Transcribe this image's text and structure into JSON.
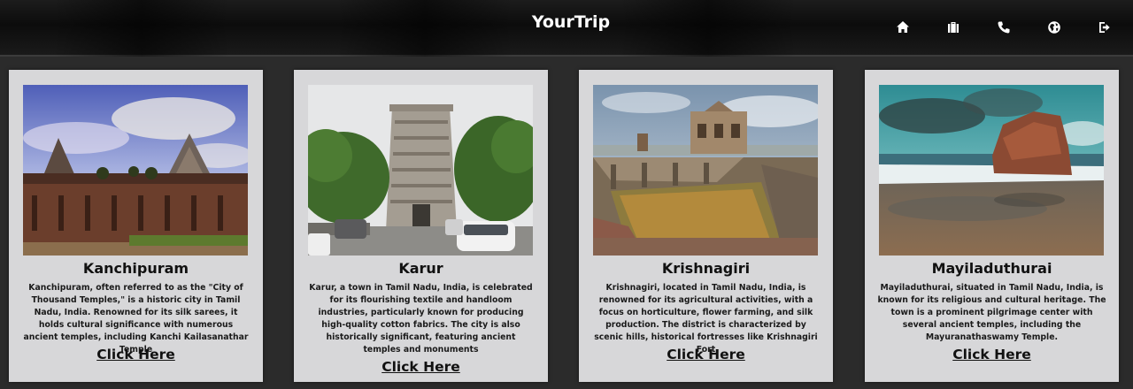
{
  "header": {
    "brand": "YourTrip",
    "nav": [
      {
        "icon": "home-icon"
      },
      {
        "icon": "briefcase-icon"
      },
      {
        "icon": "phone-icon"
      },
      {
        "icon": "globe-icon"
      },
      {
        "icon": "logout-icon"
      }
    ]
  },
  "cards": [
    {
      "title": "Kanchipuram",
      "description": "Kanchipuram, often referred to as the \"City of Thousand Temples,\" is a historic city in Tamil Nadu, India. Renowned for its silk sarees, it holds cultural significance with numerous ancient temples, including Kanchi Kailasanathar Temple",
      "link": "Click Here"
    },
    {
      "title": "Karur",
      "description": "Karur, a town in Tamil Nadu, India, is celebrated for its flourishing textile and handloom industries, particularly known for producing high-quality cotton fabrics. The city is also historically significant, featuring ancient temples and monuments",
      "link": "Click Here"
    },
    {
      "title": "Krishnagiri",
      "description": "Krishnagiri, located in Tamil Nadu, India, is renowned for its agricultural activities, with a focus on horticulture, flower farming, and silk production. The district is characterized by scenic hills, historical fortresses like Krishnagiri Fort",
      "link": "Click Here"
    },
    {
      "title": "Mayiladuthurai",
      "description": "Mayiladuthurai, situated in Tamil Nadu, India, is known for its religious and cultural heritage. The town is a prominent pilgrimage center with several ancient temples, including the Mayuranathaswamy Temple.",
      "link": "Click Here"
    }
  ]
}
